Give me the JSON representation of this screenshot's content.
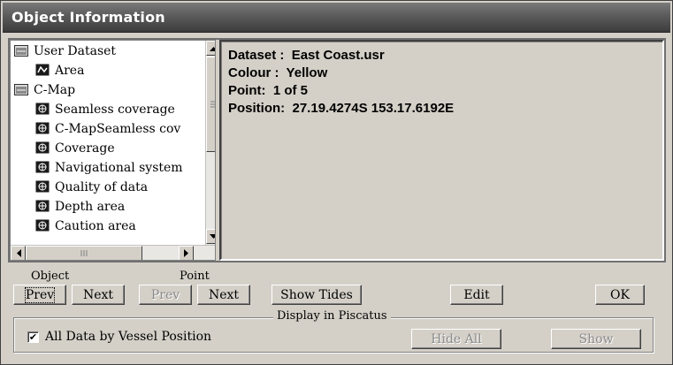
{
  "window": {
    "title": "Object Information"
  },
  "tree": {
    "items": [
      {
        "label": "User Dataset",
        "icon": "folder-icon",
        "level": 0
      },
      {
        "label": "Area",
        "icon": "area-icon",
        "level": 1
      },
      {
        "label": "C-Map",
        "icon": "folder-icon",
        "level": 0
      },
      {
        "label": "Seamless coverage",
        "icon": "chart-object-icon",
        "level": 1
      },
      {
        "label": "C-MapSeamless cov",
        "icon": "chart-object-icon",
        "level": 1
      },
      {
        "label": "Coverage",
        "icon": "chart-object-icon",
        "level": 1
      },
      {
        "label": "Navigational system",
        "icon": "chart-object-icon",
        "level": 1
      },
      {
        "label": "Quality of data",
        "icon": "chart-object-icon",
        "level": 1
      },
      {
        "label": "Depth area",
        "icon": "chart-object-icon",
        "level": 1
      },
      {
        "label": "Caution area",
        "icon": "chart-object-icon",
        "level": 1
      }
    ]
  },
  "info": {
    "dataset": "Dataset :  East Coast.usr",
    "colour": "Colour :  Yellow",
    "point": "Point:  1 of 5",
    "position": "Position:  27.19.4274S 153.17.6192E"
  },
  "controls": {
    "object_label": "Object",
    "point_label": "Point",
    "object_prev": "Prev",
    "object_next": "Next",
    "point_prev": "Prev",
    "point_next": "Next",
    "show_tides": "Show Tides",
    "edit": "Edit",
    "ok": "OK"
  },
  "display_group": {
    "label": "Display in Piscatus",
    "all_data_checkbox_label": "All Data by Vessel Position",
    "all_data_checked": true,
    "hide_all": "Hide All",
    "show": "Show"
  },
  "colors": {
    "title_bar": "#5e5e5e",
    "face": "#d4d0c8",
    "disabled_text": "#8a8a8a"
  }
}
